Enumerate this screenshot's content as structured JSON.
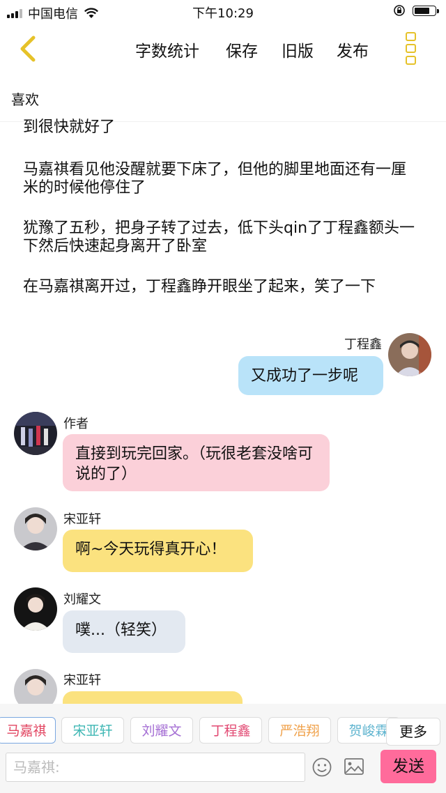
{
  "status_bar": {
    "carrier": "中国电信",
    "time": "下午10:29",
    "battery_level": 0.8
  },
  "toolbar": {
    "word_count": "字数统计",
    "save": "保存",
    "old_version": "旧版",
    "publish": "发布"
  },
  "like_label": "喜欢",
  "story_paragraphs": [
    "到很快就好了",
    "马嘉祺看见他没醒就要下床了，但他的脚里地面还有一厘米的时候他停住了",
    "犹豫了五秒，把身子转了过去，低下头qin了丁程鑫额头一下然后快速起身离开了卧室",
    "在马嘉祺离开过，丁程鑫睁开眼坐了起来，笑了一下"
  ],
  "messages": [
    {
      "name": "丁程鑫",
      "text": "又成功了一步呢",
      "side": "right",
      "color": "#b9e3f9"
    },
    {
      "name": "作者",
      "text": "直接到玩完回家。（玩很老套没啥可说的了）",
      "side": "left",
      "color": "#fbd0d9"
    },
    {
      "name": "宋亚轩",
      "text": "啊~今天玩得真开心！",
      "side": "left",
      "color": "#fbe27f"
    },
    {
      "name": "刘耀文",
      "text": "噗...（轻笑）",
      "side": "left",
      "color": "#e3e9f1"
    },
    {
      "name": "宋亚轩",
      "text": "",
      "side": "left",
      "color": "#fbe27f"
    }
  ],
  "character_tags": [
    {
      "label": "马嘉祺",
      "color": "#e24561"
    },
    {
      "label": "宋亚轩",
      "color": "#3fb7b4"
    },
    {
      "label": "刘耀文",
      "color": "#a56fd4"
    },
    {
      "label": "丁程鑫",
      "color": "#e24a73"
    },
    {
      "label": "严浩翔",
      "color": "#f0a14a"
    },
    {
      "label": "贺峻霖",
      "color": "#5fb4cf"
    }
  ],
  "more_button": "更多",
  "input": {
    "placeholder": "马嘉祺:"
  },
  "send_button": "发送",
  "colors": {
    "accent_yellow": "#e6c229",
    "send_pink": "#ff6b9b"
  }
}
